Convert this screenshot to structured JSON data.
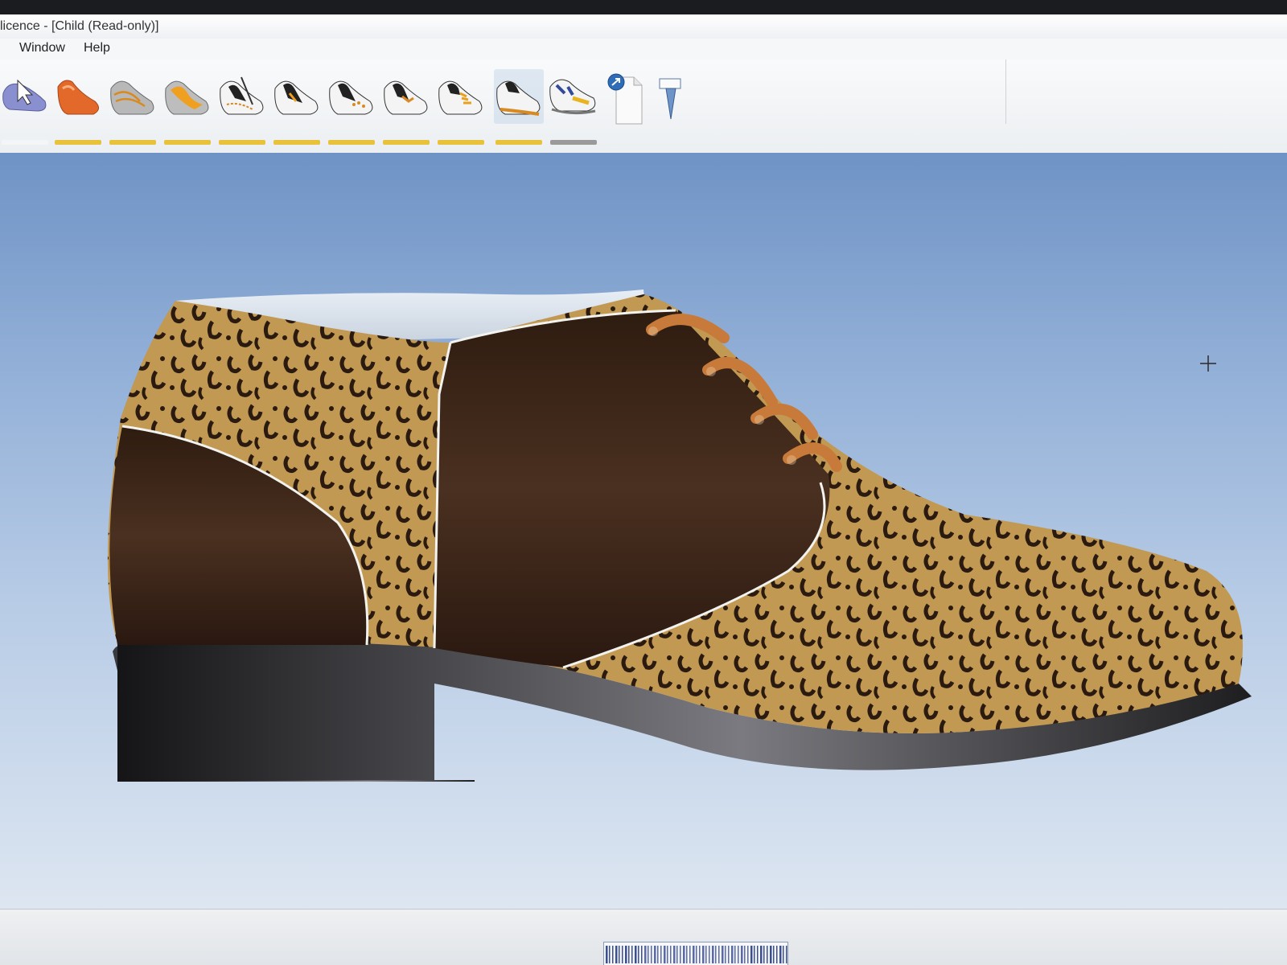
{
  "window": {
    "title": "licence - [Child (Read-only)]"
  },
  "menu": {
    "items": [
      "Window",
      "Help"
    ]
  },
  "toolbar": {
    "tools": [
      {
        "icon": "select-arrow-shoe-icon",
        "active": false,
        "underline_color": "#ffffff"
      },
      {
        "icon": "last-shoe-icon",
        "active": false,
        "underline_color": "#e7c23a"
      },
      {
        "icon": "style-lines-icon",
        "active": false,
        "underline_color": "#e7c23a"
      },
      {
        "icon": "pattern-pieces-icon",
        "active": false,
        "underline_color": "#e7c23a"
      },
      {
        "icon": "stitching-icon",
        "active": false,
        "underline_color": "#e7c23a"
      },
      {
        "icon": "lining-icon",
        "active": false,
        "underline_color": "#e7c23a"
      },
      {
        "icon": "eyelets-icon",
        "active": false,
        "underline_color": "#e7c23a"
      },
      {
        "icon": "components-icon",
        "active": false,
        "underline_color": "#e7c23a"
      },
      {
        "icon": "laces-icon",
        "active": false,
        "underline_color": "#e7c23a"
      },
      {
        "icon": "materials-icon",
        "active": true,
        "underline_color": "#e7c23a"
      },
      {
        "icon": "sole-render-icon",
        "active": false,
        "underline_color": "#9a9a9a"
      },
      {
        "icon": "export-document-icon",
        "active": false,
        "underline_color": "transparent"
      },
      {
        "icon": "pin-tool-icon",
        "active": false,
        "underline_color": "transparent"
      }
    ]
  },
  "colors": {
    "accent_underline": "#e7c23a",
    "leopard_base": "#c9a15a",
    "dark_leather": "#3a2516",
    "lace": "#c87a3a",
    "sole": "#2a2a2c",
    "stitch": "#f2f2ee"
  }
}
